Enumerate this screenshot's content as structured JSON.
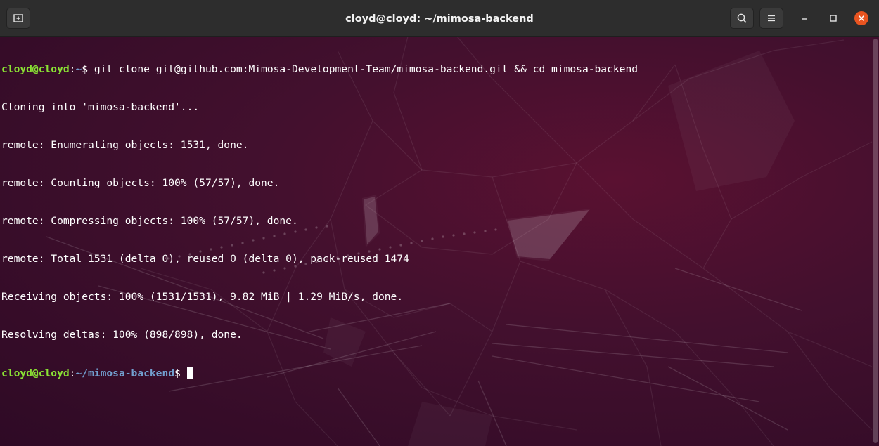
{
  "window": {
    "title": "cloyd@cloyd: ~/mimosa-backend"
  },
  "icons": {
    "new_tab": "new-tab-icon",
    "search": "search-icon",
    "menu": "hamburger-menu-icon",
    "minimize": "minimize-icon",
    "maximize": "maximize-icon",
    "close": "close-icon"
  },
  "colors": {
    "titlebar": "#2d2d2d",
    "terminal_bg": "#43102e",
    "prompt_user": "#8ae234",
    "prompt_path": "#729fcf",
    "close_button": "#e95420"
  },
  "terminal": {
    "prompt1": {
      "user": "cloyd@cloyd",
      "sep": ":",
      "path": "~",
      "symbol": "$",
      "command": " git clone git@github.com:Mimosa-Development-Team/mimosa-backend.git && cd mimosa-backend"
    },
    "output": [
      "Cloning into 'mimosa-backend'...",
      "remote: Enumerating objects: 1531, done.",
      "remote: Counting objects: 100% (57/57), done.",
      "remote: Compressing objects: 100% (57/57), done.",
      "remote: Total 1531 (delta 0), reused 0 (delta 0), pack-reused 1474",
      "Receiving objects: 100% (1531/1531), 9.82 MiB | 1.29 MiB/s, done.",
      "Resolving deltas: 100% (898/898), done."
    ],
    "prompt2": {
      "user": "cloyd@cloyd",
      "sep": ":",
      "path": "~/mimosa-backend",
      "symbol": "$ "
    }
  }
}
